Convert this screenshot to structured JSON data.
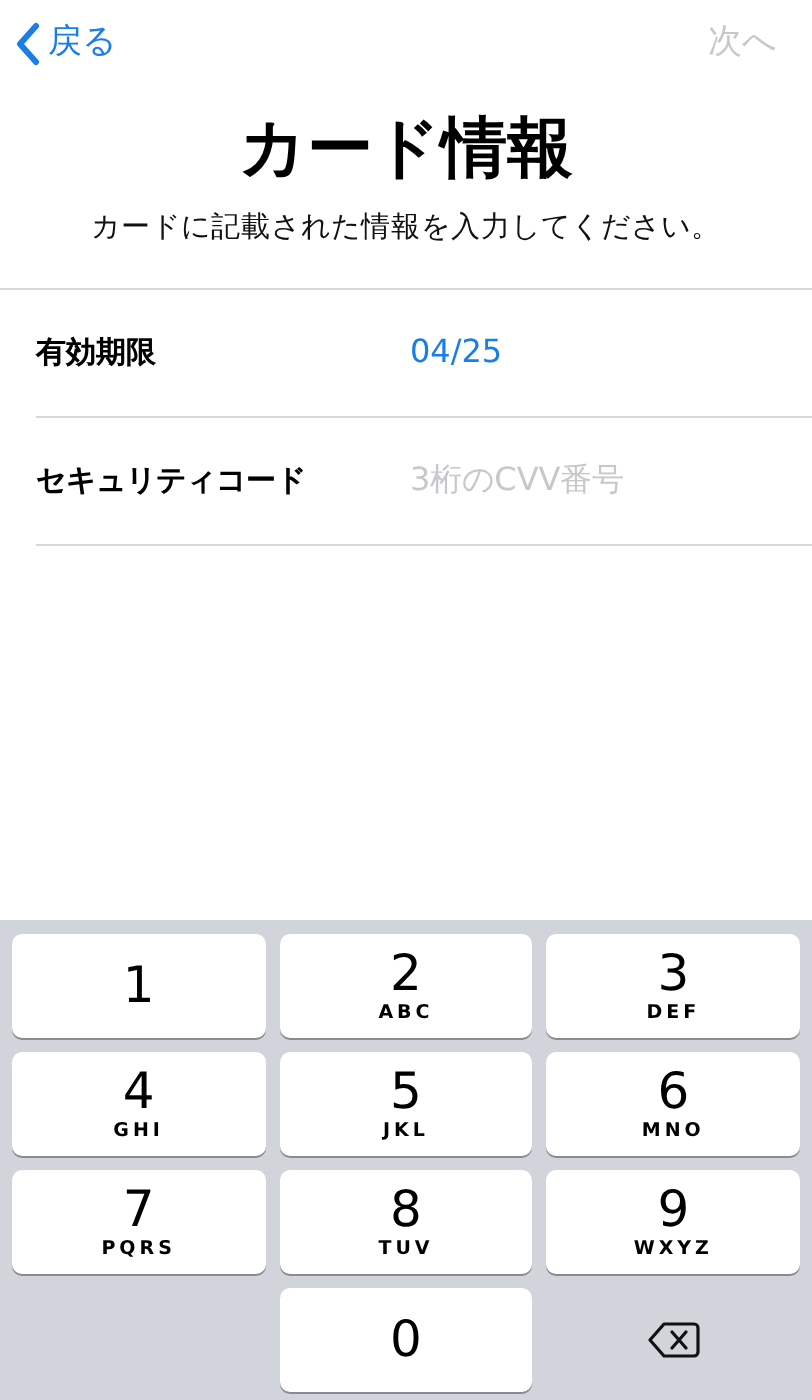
{
  "nav": {
    "back": {
      "label": "戻る"
    },
    "next": {
      "label": "次へ",
      "disabled": true
    }
  },
  "title": "カード情報",
  "subtitle": "カードに記載された情報を入力してください。",
  "fields": [
    {
      "label": "有効期限",
      "value": "04/25"
    },
    {
      "label": "セキュリティコード",
      "placeholder": "3桁のCVV番号"
    }
  ],
  "keypad": [
    {
      "kind": "digit",
      "digit": "1"
    },
    {
      "kind": "digit",
      "digit": "2",
      "letters": "ABC"
    },
    {
      "kind": "digit",
      "digit": "3",
      "letters": "DEF"
    },
    {
      "kind": "digit",
      "digit": "4",
      "letters": "GHI"
    },
    {
      "kind": "digit",
      "digit": "5",
      "letters": "JKL"
    },
    {
      "kind": "digit",
      "digit": "6",
      "letters": "MNO"
    },
    {
      "kind": "digit",
      "digit": "7",
      "letters": "PQRS"
    },
    {
      "kind": "digit",
      "digit": "8",
      "letters": "TUV"
    },
    {
      "kind": "digit",
      "digit": "9",
      "letters": "WXYZ"
    },
    {
      "kind": "blank"
    },
    {
      "kind": "digit",
      "digit": "0"
    },
    {
      "kind": "delete"
    }
  ]
}
